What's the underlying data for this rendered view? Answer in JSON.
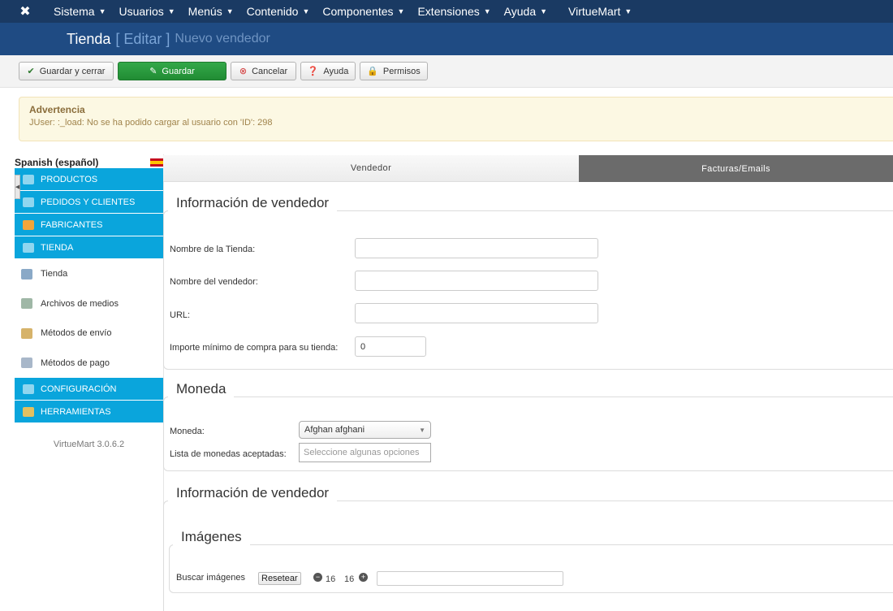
{
  "topbar": {
    "logo_icon": "joomla-icon",
    "menus": [
      {
        "label": "Sistema"
      },
      {
        "label": "Usuarios"
      },
      {
        "label": "Menús"
      },
      {
        "label": "Contenido"
      },
      {
        "label": "Componentes"
      },
      {
        "label": "Extensiones"
      },
      {
        "label": "Ayuda"
      },
      {
        "label": "VirtueMart"
      }
    ]
  },
  "titlebar": {
    "main": "Tienda",
    "action": "[ Editar ]",
    "sub": "Nuevo vendedor"
  },
  "toolbar": {
    "save_close": "Guardar y cerrar",
    "save": "Guardar",
    "cancel": "Cancelar",
    "help": "Ayuda",
    "permissions": "Permisos"
  },
  "warning": {
    "title": "Advertencia",
    "message": "JUser: :_load: No se ha podido cargar al usuario con 'ID': 298"
  },
  "sidebar": {
    "language": "Spanish (español)",
    "groups": [
      {
        "label": "PRODUCTOS"
      },
      {
        "label": "PEDIDOS Y CLIENTES"
      },
      {
        "label": "FABRICANTES"
      },
      {
        "label": "TIENDA"
      }
    ],
    "items": [
      {
        "label": "Tienda"
      },
      {
        "label": "Archivos de medios"
      },
      {
        "label": "Métodos de envío"
      },
      {
        "label": "Métodos de pago"
      }
    ],
    "groups2": [
      {
        "label": "CONFIGURACIÓN"
      },
      {
        "label": "HERRAMIENTAS"
      }
    ],
    "version": "VirtueMart 3.0.6.2"
  },
  "tabs": {
    "vendor": "Vendedor",
    "invoices": "Facturas/Emails"
  },
  "vendor_info": {
    "legend": "Información de vendedor",
    "store_name_label": "Nombre de la Tienda:",
    "store_name_value": "",
    "vendor_name_label": "Nombre del vendedor:",
    "vendor_name_value": "",
    "url_label": "URL:",
    "url_value": "",
    "min_purchase_label": "Importe mínimo de compra para su tienda:",
    "min_purchase_value": "0"
  },
  "currency": {
    "legend": "Moneda",
    "currency_label": "Moneda:",
    "currency_value": "Afghan afghani",
    "accepted_label": "Lista de monedas aceptadas:",
    "accepted_placeholder": "Seleccione algunas opciones"
  },
  "vendor_info2": {
    "legend": "Información de vendedor",
    "images": {
      "legend": "Imágenes",
      "search_label": "Buscar imágenes",
      "reset_label": "Resetear",
      "count_left": "16",
      "count_right": "16",
      "search_value": ""
    }
  },
  "colors": {
    "topbar": "#1a3a63",
    "titlebar": "#1f4b83",
    "sidebar_accent": "#0aa5dc",
    "save_green": "#27963b",
    "warning_bg": "#fcf8e3"
  }
}
